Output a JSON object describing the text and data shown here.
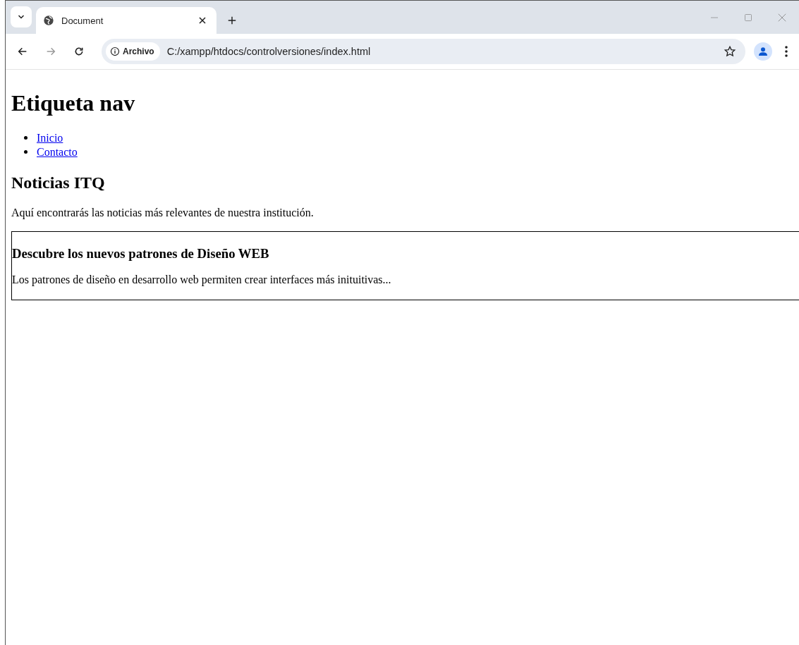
{
  "tabs": [
    {
      "title": "Document",
      "selected": true
    }
  ],
  "address_bar": {
    "chip": "Archivo",
    "url": "C:/xampp/htdocs/controlversiones/index.html"
  },
  "page": {
    "title": "Etiqueta nav",
    "nav_links": [
      "Inicio",
      "Contacto"
    ],
    "section_title": "Noticias ITQ",
    "intro": "Aquí encontrarás las noticias más relevantes de nuestra institución.",
    "article": {
      "title": "Descubre los nuevos patrones de Diseño WEB",
      "text": "Los patrones de diseño en desarrollo web permiten crear interfaces más inituitivas..."
    }
  }
}
